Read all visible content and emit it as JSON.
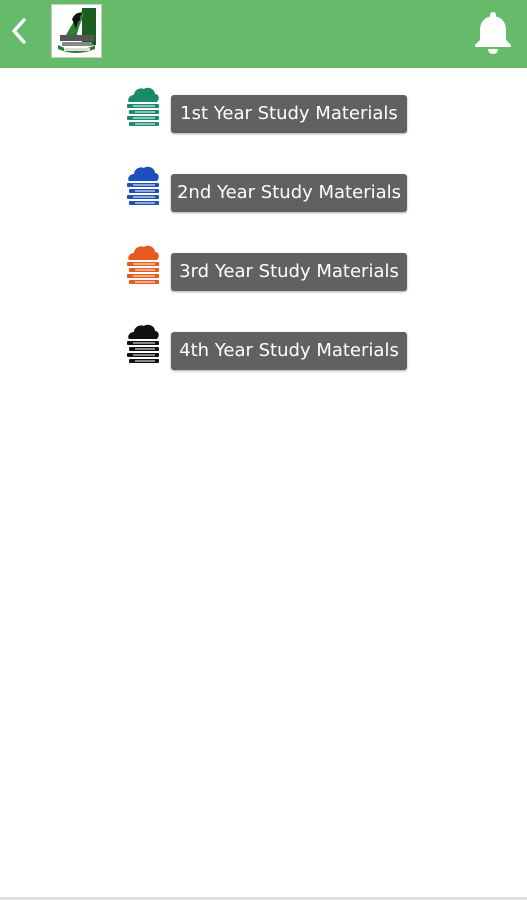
{
  "header": {
    "back_icon": "chevron-left-icon",
    "logo_icon": "college-crest-logo",
    "notification_icon": "bell-icon",
    "bar_color": "#66bb6a"
  },
  "materials": [
    {
      "label": "1st Year Study Materials",
      "icon": "books-icon",
      "color": "#1a8a6a"
    },
    {
      "label": "2nd Year Study Materials",
      "icon": "books-icon",
      "color": "#1e4fbf"
    },
    {
      "label": "3rd Year Study Materials",
      "icon": "books-icon",
      "color": "#e8591f"
    },
    {
      "label": "4th Year Study Materials",
      "icon": "books-icon",
      "color": "#111111"
    }
  ]
}
